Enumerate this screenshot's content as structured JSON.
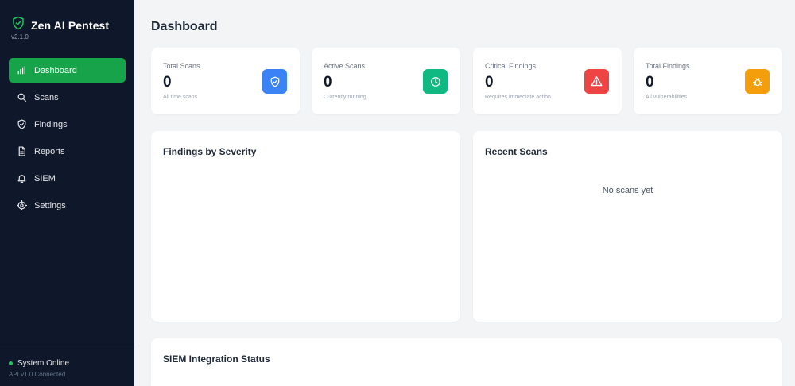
{
  "sidebar": {
    "brand": {
      "title": "Zen AI Pentest",
      "version": "v2.1.0",
      "icon": "shield-check-icon"
    },
    "items": [
      {
        "label": "Dashboard",
        "icon": "bar-chart-icon",
        "active": true
      },
      {
        "label": "Scans",
        "icon": "search-icon",
        "active": false
      },
      {
        "label": "Findings",
        "icon": "shield-icon",
        "active": false
      },
      {
        "label": "Reports",
        "icon": "file-icon",
        "active": false
      },
      {
        "label": "SIEM",
        "icon": "bell-icon",
        "active": false
      },
      {
        "label": "Settings",
        "icon": "gear-icon",
        "active": false
      }
    ],
    "status": {
      "label": "System Online",
      "sub": "API v1.0 Connected"
    }
  },
  "main": {
    "title": "Dashboard",
    "stats": [
      {
        "label": "Total Scans",
        "value": "0",
        "sub": "All time scans",
        "icon": "shield-check-icon",
        "color": "#3b82f6"
      },
      {
        "label": "Active Scans",
        "value": "0",
        "sub": "Currently running",
        "icon": "clock-icon",
        "color": "#10b981"
      },
      {
        "label": "Critical Findings",
        "value": "0",
        "sub": "Requires immediate action",
        "icon": "warning-icon",
        "color": "#ef4444"
      },
      {
        "label": "Total Findings",
        "value": "0",
        "sub": "All vulnerabilities",
        "icon": "bug-icon",
        "color": "#f59e0b"
      }
    ],
    "findings_by_severity": {
      "title": "Findings by Severity"
    },
    "recent_scans": {
      "title": "Recent Scans",
      "empty": "No scans yet"
    },
    "siem_status": {
      "title": "SIEM Integration Status"
    }
  },
  "colors": {
    "sidebar_bg": "#0f172a",
    "accent": "#16a34a",
    "page_bg": "#f3f4f6"
  }
}
